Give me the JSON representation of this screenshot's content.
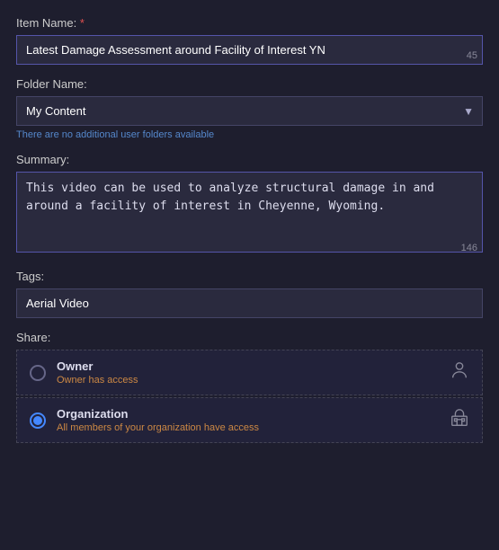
{
  "itemName": {
    "label": "Item Name:",
    "required": true,
    "required_symbol": "*",
    "value": "Latest Damage Assessment around Facility of Interest YN",
    "char_count": "45"
  },
  "folderName": {
    "label": "Folder Name:",
    "selected": "My Content",
    "options": [
      "My Content"
    ],
    "hint": "There are no additional user folders available"
  },
  "summary": {
    "label": "Summary:",
    "value": "This video can be used to analyze structural damage in and around a facility of interest in Cheyenne, Wyoming.",
    "char_count": "146"
  },
  "tags": {
    "label": "Tags:",
    "value": "Aerial Video"
  },
  "share": {
    "label": "Share:",
    "options": [
      {
        "id": "owner",
        "title": "Owner",
        "subtitle": "Owner has access",
        "selected": false,
        "icon": "person"
      },
      {
        "id": "organization",
        "title": "Organization",
        "subtitle": "All members of your organization have access",
        "selected": true,
        "icon": "org"
      }
    ]
  },
  "colors": {
    "accent_blue": "#4488ff",
    "accent_orange": "#cc8844",
    "required_red": "#e05050",
    "bg_dark": "#1e1e2e",
    "input_bg": "#2a2a3e",
    "border_active": "#5555aa",
    "border_normal": "#444466"
  }
}
